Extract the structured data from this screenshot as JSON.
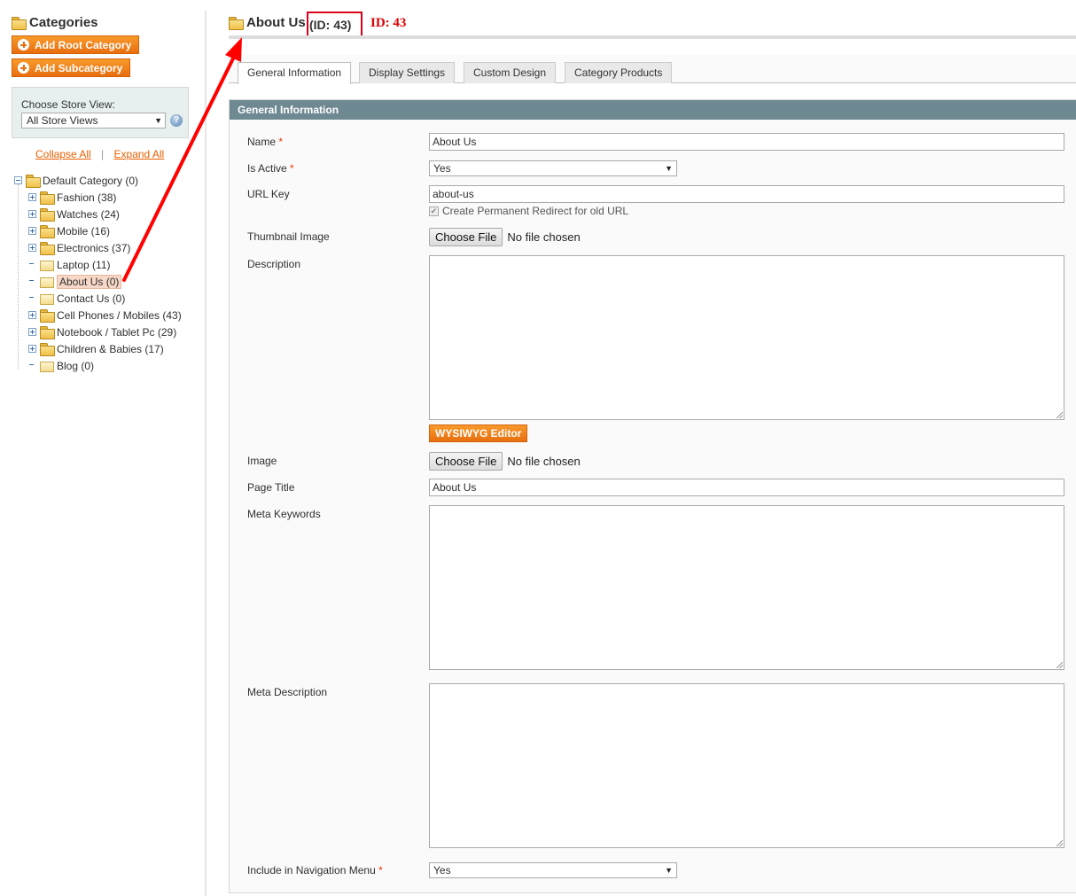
{
  "sidebar": {
    "title": "Categories",
    "add_root_label": "Add Root Category",
    "add_sub_label": "Add Subcategory",
    "store_view_label": "Choose Store View:",
    "store_view_value": "All Store Views",
    "help_glyph": "?",
    "collapse_all": "Collapse All",
    "expand_all": "Expand All",
    "separator": "|",
    "tree": [
      {
        "label": "Default Category (0)",
        "level": 0,
        "toggle": "minus",
        "icon": "folder-search"
      },
      {
        "label": "Fashion (38)",
        "level": 1,
        "toggle": "plus",
        "icon": "folder"
      },
      {
        "label": "Watches (24)",
        "level": 1,
        "toggle": "plus",
        "icon": "folder"
      },
      {
        "label": "Mobile (16)",
        "level": 1,
        "toggle": "plus",
        "icon": "folder"
      },
      {
        "label": "Electronics (37)",
        "level": 1,
        "toggle": "plus",
        "icon": "folder"
      },
      {
        "label": "Laptop (11)",
        "level": 1,
        "toggle": "none",
        "icon": "leaf"
      },
      {
        "label": "About Us (0)",
        "level": 1,
        "toggle": "none",
        "icon": "leaf",
        "selected": true
      },
      {
        "label": "Contact Us (0)",
        "level": 1,
        "toggle": "none",
        "icon": "leaf"
      },
      {
        "label": "Cell Phones / Mobiles (43)",
        "level": 1,
        "toggle": "plus",
        "icon": "folder"
      },
      {
        "label": "Notebook / Tablet Pc (29)",
        "level": 1,
        "toggle": "plus",
        "icon": "folder"
      },
      {
        "label": "Children & Babies (17)",
        "level": 1,
        "toggle": "plus",
        "icon": "folder"
      },
      {
        "label": "Blog (0)",
        "level": 1,
        "toggle": "none",
        "icon": "leaf"
      }
    ]
  },
  "header": {
    "title": "About Us",
    "id_text": "(ID: 43)",
    "annotation": "ID: 43"
  },
  "tabs": [
    {
      "label": "General Information",
      "active": true
    },
    {
      "label": "Display Settings",
      "active": false
    },
    {
      "label": "Custom Design",
      "active": false
    },
    {
      "label": "Category Products",
      "active": false
    }
  ],
  "form": {
    "section_title": "General Information",
    "required_mark": "*",
    "name_label": "Name",
    "name_value": "About Us",
    "is_active_label": "Is Active",
    "is_active_value": "Yes",
    "url_key_label": "URL Key",
    "url_key_value": "about-us",
    "redirect_label": "Create Permanent Redirect for old URL",
    "redirect_checked": true,
    "thumbnail_label": "Thumbnail Image",
    "choose_file": "Choose File",
    "no_file": "No file chosen",
    "description_label": "Description",
    "description_value": "",
    "wysiwyg_label": "WYSIWYG Editor",
    "image_label": "Image",
    "page_title_label": "Page Title",
    "page_title_value": "About Us",
    "meta_keywords_label": "Meta Keywords",
    "meta_keywords_value": "",
    "meta_description_label": "Meta Description",
    "meta_description_value": "",
    "nav_menu_label": "Include in Navigation Menu",
    "nav_menu_value": "Yes"
  },
  "colors": {
    "accent_orange": "#e86e0f",
    "section_header": "#6f8992",
    "annotation_red": "#e00000"
  }
}
